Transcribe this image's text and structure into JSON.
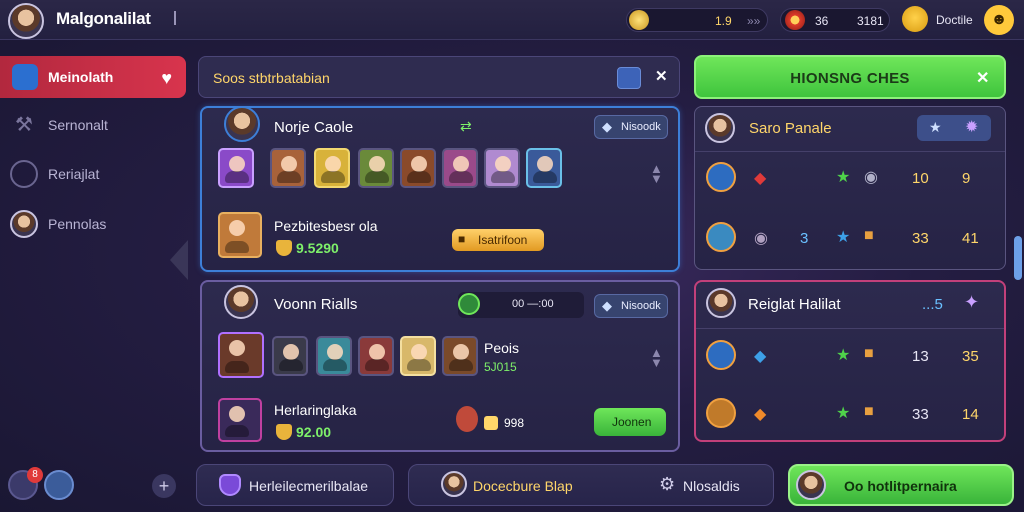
{
  "header": {
    "player_name": "Malgonalilat",
    "resources": [
      {
        "icon": "coin-icon",
        "value": "1.9",
        "trail": "»»"
      },
      {
        "icon": "ruby-icon",
        "value": "36",
        "value2": "3181"
      },
      {
        "icon": "smiley-icon",
        "value": "Doctile"
      }
    ]
  },
  "sidebar": {
    "items": [
      {
        "label": "Meinolath",
        "icon": "cube-icon",
        "active": true
      },
      {
        "label": "Sernonalt",
        "icon": "wrench-icon"
      },
      {
        "label": "Reriajlat",
        "icon": "globe-icon"
      },
      {
        "label": "Pennolas",
        "icon": "portrait-icon"
      }
    ],
    "notification_count": "8"
  },
  "search": {
    "text": "Soos stbtrbatabian"
  },
  "promo": {
    "label": "HIONSNG CHES"
  },
  "cards": [
    {
      "name": "Norje Caole",
      "action_label": "Nisoodk",
      "featured_name": "Pezbitesbesr ola",
      "price": "9.5290",
      "buy_label": "Isatrifoon"
    },
    {
      "name": "Voonn Rialls",
      "timer": "00 —:00",
      "action_label": "Nisoodk",
      "featured_name": "Herlaringlaka",
      "price": "92.00",
      "extra_name": "Peois",
      "extra_value": "5J015",
      "side_value": "998",
      "join_label": "Joonen"
    }
  ],
  "leaderboards": [
    {
      "title": "Saro Panale",
      "rows": [
        {
          "mid": "",
          "v1": "10",
          "v2": "9"
        },
        {
          "mid": "3",
          "v1": "33",
          "v2": "41"
        }
      ]
    },
    {
      "title": "Reiglat Halilat",
      "header_value": "...5",
      "rows": [
        {
          "mid": "",
          "v1": "13",
          "v2": "35"
        },
        {
          "mid": "",
          "v1": "33",
          "v2": "14"
        }
      ]
    }
  ],
  "bottom": {
    "btn1": "Herleilecmerilbalae",
    "btn2": "Docecbure Blap",
    "btn3": "Nlosaldis",
    "btn4": "Oo hotlitpernaira"
  },
  "colors": {
    "accent_red": "#d8344d",
    "accent_green": "#4fd24a",
    "gold": "#ffd66a",
    "panel_blue": "#3d7fd8"
  }
}
